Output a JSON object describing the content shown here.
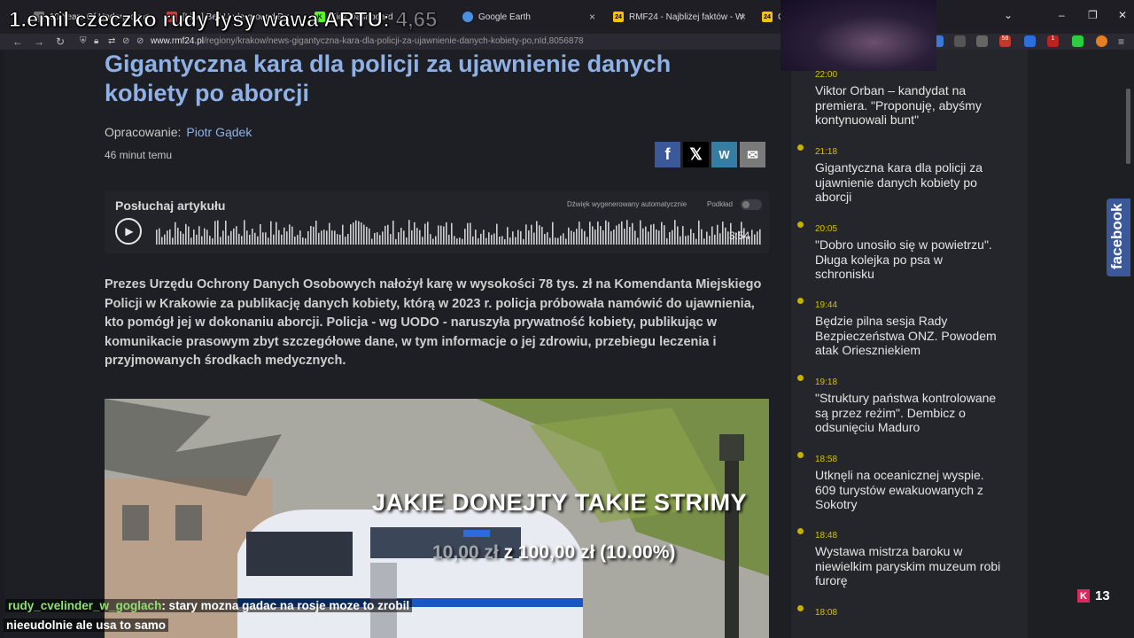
{
  "browser": {
    "tabs": [
      {
        "title": "10 Years Of Underground",
        "color": "#777777"
      },
      {
        "title": "[Live] Bell Underground Bro",
        "color": "#e03030"
      },
      {
        "title": "Kick Dashboard",
        "color": "#53fc18"
      },
      {
        "title": "Google Earth",
        "color": "#4a90e2"
      },
      {
        "title": "RMF24 - Najbliżej faktów - Wyd",
        "color": "#f5c300"
      },
      {
        "title": "Gi",
        "color": "#f5c300"
      }
    ],
    "favicon_label": "24",
    "close_glyph": "×",
    "url_domain": "www.rmf24.pl",
    "url_path": "/regiony/krakow/news-gigantyczna-kara-dla-policji-za-ujawnienie-danych-kobiety-po,nId,8056878",
    "badges": {
      "ext1": "58",
      "ext2": "1"
    }
  },
  "article": {
    "title": "Gigantyczna kara dla policji za ujawnienie danych kobiety po aborcji",
    "byline_label": "Opracowanie:",
    "author": "Piotr Gądek",
    "time_ago": "46 minut temu",
    "player": {
      "title": "Posłuchaj artykułu",
      "note": "Dźwięk wygenerowany automatycznie",
      "podcast_label": "Podkład",
      "duration": "3:54"
    },
    "lead": "Prezes Urzędu Ochrony Danych Osobowych nałożył karę w wysokości 78 tys. zł na Komendanta Miejskiego Policji w Krakowie za publikację danych kobiety, którą w 2023 r. policja próbowała namówić do ujawnienia, kto pomógł jej w dokonaniu aborcji. Policja - wg UODO - naruszyła prywatność kobiety, publikując w komunikacie prasowym zbyt szczegółowe dane, w tym informacje o jej zdrowiu, przebiegu leczenia i przyjmowanych środkach medycznych."
  },
  "sidebar": {
    "items": [
      {
        "time": "22:00",
        "headline": "Viktor Orban – kandydat na premiera. \"Proponuję, abyśmy kontynuowali bunt\""
      },
      {
        "time": "21:18",
        "headline": "Gigantyczna kara dla policji za ujawnienie danych kobiety po aborcji"
      },
      {
        "time": "20:05",
        "headline": "\"Dobro unosiło się w powietrzu\". Długa kolejka po psa w schronisku"
      },
      {
        "time": "19:44",
        "headline": "Będzie pilna sesja Rady Bezpieczeństwa ONZ. Powodem atak Orieszniekiem"
      },
      {
        "time": "19:18",
        "headline": "\"Struktury państwa kontrolowane są przez reżim\". Dembicz o odsunięciu Maduro"
      },
      {
        "time": "18:58",
        "headline": "Utknęli na oceanicznej wyspie. 609 turystów ewakuowanych z Sokotry"
      },
      {
        "time": "18:48",
        "headline": "Wystawa mistrza baroku w niewielkim paryskim muzeum robi furorę"
      },
      {
        "time": "18:08",
        "headline": ""
      }
    ],
    "facebook_label": "facebook"
  },
  "overlay": {
    "top_text": "1.emil czeczko rudy łysy wawa ARTU:",
    "top_value": "4,65",
    "donate_banner": "JAKIE DONEJTY TAKIE STRIMY",
    "goal_current": "10,00 zł",
    "goal_sep": "z",
    "goal_target": "100,00 zł",
    "goal_pct": "(10.00%)",
    "chat_user": "rudy_cvelinder_w_goglach",
    "chat_line1": ": stary mozna gadac na rosje moze to zrobil",
    "chat_line2": "nieeudolnie ale usa to samo",
    "viewers": "13",
    "kick_letter": "K"
  },
  "colors": {
    "accent_link": "#8fb1e6",
    "time_yellow": "#d2c100",
    "facebook": "#3b5998",
    "twitter": "#000000",
    "wykop": "#367da3",
    "mail": "#7a7a7a"
  }
}
